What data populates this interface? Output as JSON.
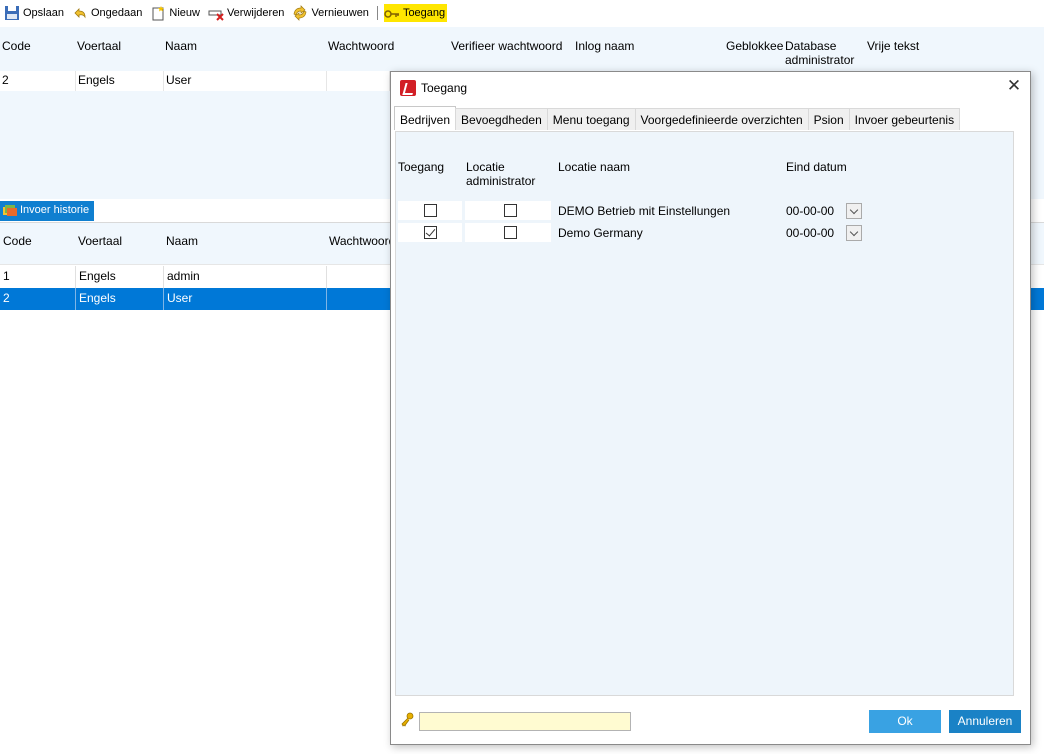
{
  "toolbar": {
    "save": "Opslaan",
    "undo": "Ongedaan",
    "new": "Nieuw",
    "delete": "Verwijderen",
    "refresh": "Vernieuwen",
    "access": "Toegang"
  },
  "top_grid": {
    "headers": [
      "Code",
      "Voertaal",
      "Naam",
      "Wachtwoord",
      "Verifieer wachtwoord",
      "Inlog naam",
      "Geblokkee",
      "Database administrator",
      "Vrije tekst"
    ],
    "row": {
      "code": "2",
      "language": "Engels",
      "name": "User"
    }
  },
  "history": {
    "button_label": "Invoer historie",
    "headers": [
      "Code",
      "Voertaal",
      "Naam",
      "Wachtwoord"
    ],
    "rows": [
      {
        "code": "1",
        "language": "Engels",
        "name": "admin"
      },
      {
        "code": "2",
        "language": "Engels",
        "name": "User"
      }
    ],
    "selected_index": 1
  },
  "dialog": {
    "title": "Toegang",
    "close_icon": "close-icon",
    "tabs": [
      "Bedrijven",
      "Bevoegdheden",
      "Menu toegang",
      "Voorgedefinieerde overzichten",
      "Psion",
      "Invoer gebeurtenis"
    ],
    "active_tab": 0,
    "columns": {
      "access": "Toegang",
      "location_admin": "Locatie administrator",
      "location_name": "Locatie naam",
      "end_date": "Eind datum"
    },
    "rows": [
      {
        "access": false,
        "location_admin": false,
        "location_name": "DEMO Betrieb mit Einstellungen",
        "end_date": "00-00-00"
      },
      {
        "access": true,
        "location_admin": false,
        "location_name": "Demo Germany",
        "end_date": "00-00-00"
      }
    ],
    "note_value": "",
    "ok_label": "Ok",
    "cancel_label": "Annuleren"
  },
  "colors": {
    "selection": "#0078d7",
    "grid_bg": "#f0f7fd",
    "toolbar_active": "#ffe600",
    "ok_button": "#39a2e3",
    "cancel_button": "#1a82c6"
  }
}
